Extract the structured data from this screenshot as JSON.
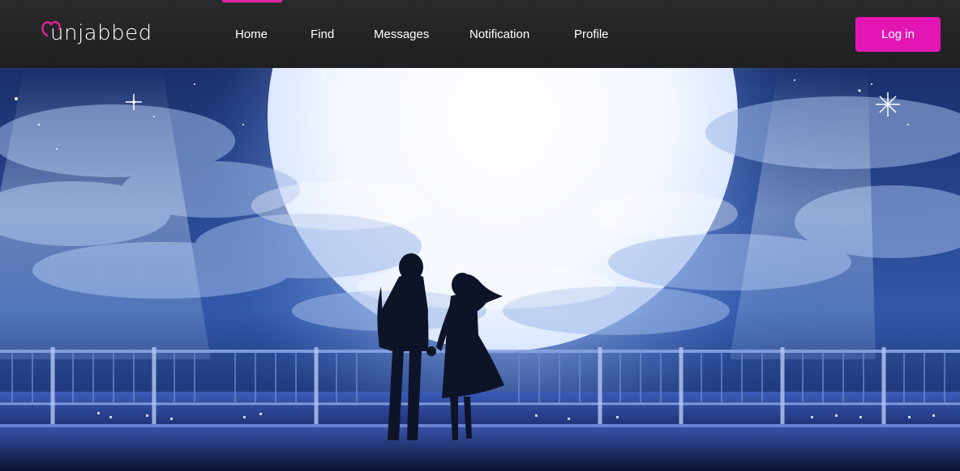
{
  "brand": {
    "name": "unjabbed",
    "accent_color": "#e316b4"
  },
  "nav": {
    "active": "Home",
    "items": [
      {
        "label": "Home"
      },
      {
        "label": "Find"
      },
      {
        "label": "Messages"
      },
      {
        "label": "Notification"
      },
      {
        "label": "Profile"
      }
    ]
  },
  "auth": {
    "login_label": "Log in"
  },
  "hero": {
    "scene": "night-sky-moon-couple-illustration"
  }
}
